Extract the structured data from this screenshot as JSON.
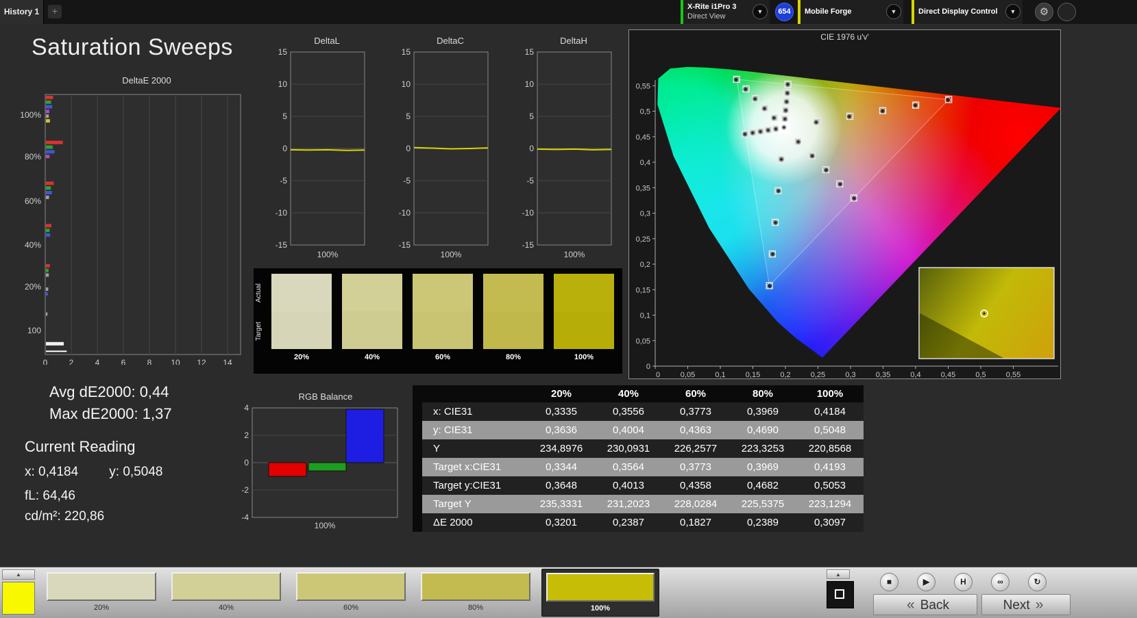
{
  "icons": {
    "plus": "+",
    "dropdown": "▼",
    "gear": "⚙",
    "up_arrow": "▲",
    "stop": "■",
    "play": "▶",
    "step": "H",
    "infinity": "∞",
    "refresh": "↻",
    "back_chevron": "«",
    "next_chevron": "»"
  },
  "top_bar": {
    "history_tab": "History 1",
    "meter_line1": "X-Rite i1Pro 3",
    "meter_line2": "Direct View",
    "meter_accent": "#18c518",
    "badge": "654",
    "badge_color": "#1d3fd8",
    "pattern_source": "Mobile Forge",
    "pattern_source_accent": "#d8d400",
    "display_control": "Direct Display Control",
    "display_control_accent": "#d8d400"
  },
  "page_title": "Saturation Sweeps",
  "readings": {
    "avg": "Avg dE2000: 0,44",
    "max": "Max dE2000: 1,37",
    "current_label": "Current Reading",
    "x": "x: 0,4184",
    "y": "y: 0,5048",
    "fl": "fL: 64,46",
    "cd": "cd/m²: 220,86"
  },
  "swatch_strip": {
    "row_top": "Actual",
    "row_bottom": "Target",
    "swatches": [
      {
        "label": "20%",
        "actual": "#d9d8bd",
        "target": "#d6d5b8"
      },
      {
        "label": "40%",
        "actual": "#d2cf97",
        "target": "#cfcc92"
      },
      {
        "label": "60%",
        "actual": "#ccc777",
        "target": "#c9c472"
      },
      {
        "label": "80%",
        "actual": "#c4bb50",
        "target": "#c1b84b"
      },
      {
        "label": "100%",
        "actual": "#bab00c",
        "target": "#b7ad08"
      }
    ]
  },
  "table": {
    "columns": [
      "20%",
      "40%",
      "60%",
      "80%",
      "100%"
    ],
    "rows": [
      {
        "label": "x: CIE31",
        "values": [
          "0,3335",
          "0,3556",
          "0,3773",
          "0,3969",
          "0,4184"
        ]
      },
      {
        "label": "y: CIE31",
        "values": [
          "0,3636",
          "0,4004",
          "0,4363",
          "0,4690",
          "0,5048"
        ]
      },
      {
        "label": "Y",
        "values": [
          "234,8976",
          "230,0931",
          "226,2577",
          "223,3253",
          "220,8568"
        ]
      },
      {
        "label": "Target x:CIE31",
        "values": [
          "0,3344",
          "0,3564",
          "0,3773",
          "0,3969",
          "0,4193"
        ]
      },
      {
        "label": "Target y:CIE31",
        "values": [
          "0,3648",
          "0,4013",
          "0,4358",
          "0,4682",
          "0,5053"
        ]
      },
      {
        "label": "Target Y",
        "values": [
          "235,3331",
          "231,2023",
          "228,0284",
          "225,5375",
          "223,1294"
        ]
      },
      {
        "label": "ΔE 2000",
        "values": [
          "0,3201",
          "0,2387",
          "0,1827",
          "0,2389",
          "0,3097"
        ]
      }
    ]
  },
  "bottom_bar": {
    "current_swatch_color": "#f8f800",
    "patches": [
      {
        "label": "20%",
        "color": "#d9d8bd",
        "selected": false
      },
      {
        "label": "40%",
        "color": "#d2cf97",
        "selected": false
      },
      {
        "label": "60%",
        "color": "#ccc777",
        "selected": false
      },
      {
        "label": "80%",
        "color": "#c4bb50",
        "selected": false
      },
      {
        "label": "100%",
        "color": "#c6bd07",
        "selected": true
      }
    ],
    "back_label": "Back",
    "next_label": "Next"
  },
  "chart_data": [
    {
      "type": "bar",
      "title": "DeltaE 2000",
      "orientation": "horizontal",
      "xlim": [
        0,
        15
      ],
      "xticks": [
        0,
        2,
        4,
        6,
        8,
        10,
        12,
        14
      ],
      "row_labels": [
        {
          "text": "100%",
          "f": 0.079
        },
        {
          "text": "80%",
          "f": 0.239
        },
        {
          "text": "60%",
          "f": 0.411
        },
        {
          "text": "40%",
          "f": 0.579
        },
        {
          "text": "20%",
          "f": 0.739
        },
        {
          "text": "100",
          "f": 0.908
        }
      ],
      "bars": [
        {
          "color": "#e03030",
          "value": 0.55,
          "f": 0.005
        },
        {
          "color": "#2fa32f",
          "value": 0.4,
          "f": 0.023
        },
        {
          "color": "#4055d8",
          "value": 0.48,
          "f": 0.041
        },
        {
          "color": "#b050b0",
          "value": 0.26,
          "f": 0.059
        },
        {
          "color": "#a0a0a0",
          "value": 0.22,
          "f": 0.077
        },
        {
          "color": "#c8c832",
          "value": 0.31,
          "f": 0.095
        },
        {
          "color": "#e03030",
          "value": 1.3,
          "f": 0.178
        },
        {
          "color": "#2fa32f",
          "value": 0.52,
          "f": 0.196
        },
        {
          "color": "#4055d8",
          "value": 0.66,
          "f": 0.214
        },
        {
          "color": "#b050b0",
          "value": 0.28,
          "f": 0.232
        },
        {
          "color": "#e03030",
          "value": 0.6,
          "f": 0.335
        },
        {
          "color": "#2fa32f",
          "value": 0.38,
          "f": 0.353
        },
        {
          "color": "#4055d8",
          "value": 0.46,
          "f": 0.371
        },
        {
          "color": "#a0a0a0",
          "value": 0.24,
          "f": 0.389
        },
        {
          "color": "#e03030",
          "value": 0.42,
          "f": 0.498
        },
        {
          "color": "#2fa32f",
          "value": 0.28,
          "f": 0.516
        },
        {
          "color": "#4055d8",
          "value": 0.33,
          "f": 0.534
        },
        {
          "color": "#e03030",
          "value": 0.3,
          "f": 0.652
        },
        {
          "color": "#2fa32f",
          "value": 0.2,
          "f": 0.67
        },
        {
          "color": "#a0a0a0",
          "value": 0.22,
          "f": 0.688
        },
        {
          "color": "#a0a0a0",
          "value": 0.18,
          "f": 0.742
        },
        {
          "color": "#4055d8",
          "value": 0.15,
          "f": 0.76
        },
        {
          "color": "#a0a0a0",
          "value": 0.12,
          "f": 0.838
        },
        {
          "color": "#f0f0f0",
          "value": 1.37,
          "f": 0.952
        },
        {
          "color": "#ffffff",
          "value": 1.6,
          "f": 0.985,
          "h": 2
        }
      ]
    },
    {
      "type": "line",
      "title": "DeltaL",
      "ylim": [
        -15,
        15
      ],
      "yticks": [
        15,
        10,
        5,
        0,
        -5,
        -10,
        -15
      ],
      "x_axis_label": "100%",
      "line_color": "#d6d600",
      "values": [
        -0.2,
        -0.25,
        -0.2,
        -0.3,
        -0.25
      ]
    },
    {
      "type": "line",
      "title": "DeltaC",
      "ylim": [
        -15,
        15
      ],
      "yticks": [
        15,
        10,
        5,
        0,
        -5,
        -10,
        -15
      ],
      "x_axis_label": "100%",
      "line_color": "#d6d600",
      "values": [
        0.15,
        0.05,
        -0.05,
        0.0,
        0.1
      ]
    },
    {
      "type": "line",
      "title": "DeltaH",
      "ylim": [
        -15,
        15
      ],
      "yticks": [
        15,
        10,
        5,
        0,
        -5,
        -10,
        -15
      ],
      "x_axis_label": "100%",
      "line_color": "#d6d600",
      "values": [
        -0.1,
        -0.15,
        -0.1,
        -0.2,
        -0.15
      ]
    },
    {
      "type": "bar",
      "title": "RGB Balance",
      "ylim": [
        -4,
        4
      ],
      "yticks": [
        4,
        2,
        0,
        -2,
        -4
      ],
      "x_axis_label": "100%",
      "categories": [
        "Red",
        "Green",
        "Blue"
      ],
      "values": [
        -1.0,
        -0.6,
        3.9
      ],
      "colors": [
        "#e20000",
        "#1e9e1e",
        "#1e1ee2"
      ]
    },
    {
      "type": "scatter",
      "title": "CIE 1976 u'v'",
      "tick_values": [
        0,
        0.05,
        0.1,
        0.15,
        0.2,
        0.25,
        0.3,
        0.35,
        0.4,
        0.45,
        0.5,
        0.55
      ],
      "x_ticks": [
        "0",
        "0,05",
        "0,1",
        "0,15",
        "0,2",
        "0,25",
        "0,3",
        "0,35",
        "0,4",
        "0,45",
        "0,5",
        "0,55"
      ],
      "y_ticks": [
        "0",
        "0,05",
        "0,1",
        "0,15",
        "0,2",
        "0,25",
        "0,3",
        "0,35",
        "0,4",
        "0,45",
        "0,5",
        "0,55"
      ],
      "white_point": [
        0.1978,
        0.4683
      ],
      "selected": [
        0.1978,
        0.4683
      ],
      "targets": [
        [
          0.2484,
          0.4792
        ],
        [
          0.299,
          0.4901
        ],
        [
          0.3495,
          0.5011
        ],
        [
          0.4001,
          0.512
        ],
        [
          0.4507,
          0.5229
        ],
        [
          0.1832,
          0.4871
        ],
        [
          0.1687,
          0.506
        ],
        [
          0.1541,
          0.5248
        ],
        [
          0.1396,
          0.5437
        ],
        [
          0.125,
          0.5625
        ],
        [
          0.1933,
          0.4062
        ],
        [
          0.1888,
          0.3441
        ],
        [
          0.1843,
          0.282
        ],
        [
          0.1799,
          0.22
        ],
        [
          0.1754,
          0.1579
        ],
        [
          0.1859,
          0.4657
        ],
        [
          0.174,
          0.4632
        ],
        [
          0.1621,
          0.4606
        ],
        [
          0.1503,
          0.4581
        ],
        [
          0.1384,
          0.4555
        ],
        [
          0.2192,
          0.4406
        ],
        [
          0.2407,
          0.4129
        ],
        [
          0.2621,
          0.3852
        ],
        [
          0.2835,
          0.3575
        ],
        [
          0.305,
          0.3298
        ],
        [
          0.199,
          0.4852
        ],
        [
          0.2002,
          0.5021
        ],
        [
          0.2015,
          0.519
        ],
        [
          0.2027,
          0.536
        ],
        [
          0.2039,
          0.5529
        ]
      ],
      "measurements": [
        [
          0.2473,
          0.4784
        ],
        [
          0.2981,
          0.4895
        ],
        [
          0.3492,
          0.5004
        ],
        [
          0.3996,
          0.5116
        ],
        [
          0.4495,
          0.5221
        ],
        [
          0.1825,
          0.4868
        ],
        [
          0.1679,
          0.5052
        ],
        [
          0.1534,
          0.5242
        ],
        [
          0.1389,
          0.5431
        ],
        [
          0.1243,
          0.5618
        ],
        [
          0.1938,
          0.4057
        ],
        [
          0.1893,
          0.3436
        ],
        [
          0.1848,
          0.2815
        ],
        [
          0.1804,
          0.2196
        ],
        [
          0.1759,
          0.1574
        ],
        [
          0.1853,
          0.4652
        ],
        [
          0.1734,
          0.4628
        ],
        [
          0.1616,
          0.4601
        ],
        [
          0.1497,
          0.4576
        ],
        [
          0.1379,
          0.455
        ],
        [
          0.2197,
          0.44
        ],
        [
          0.2412,
          0.4123
        ],
        [
          0.2626,
          0.3846
        ],
        [
          0.284,
          0.3569
        ],
        [
          0.3055,
          0.3292
        ],
        [
          0.1993,
          0.4847
        ],
        [
          0.2005,
          0.5016
        ],
        [
          0.2018,
          0.5186
        ],
        [
          0.203,
          0.5355
        ],
        [
          0.2036,
          0.5526
        ],
        [
          0.1978,
          0.4683
        ]
      ]
    }
  ]
}
